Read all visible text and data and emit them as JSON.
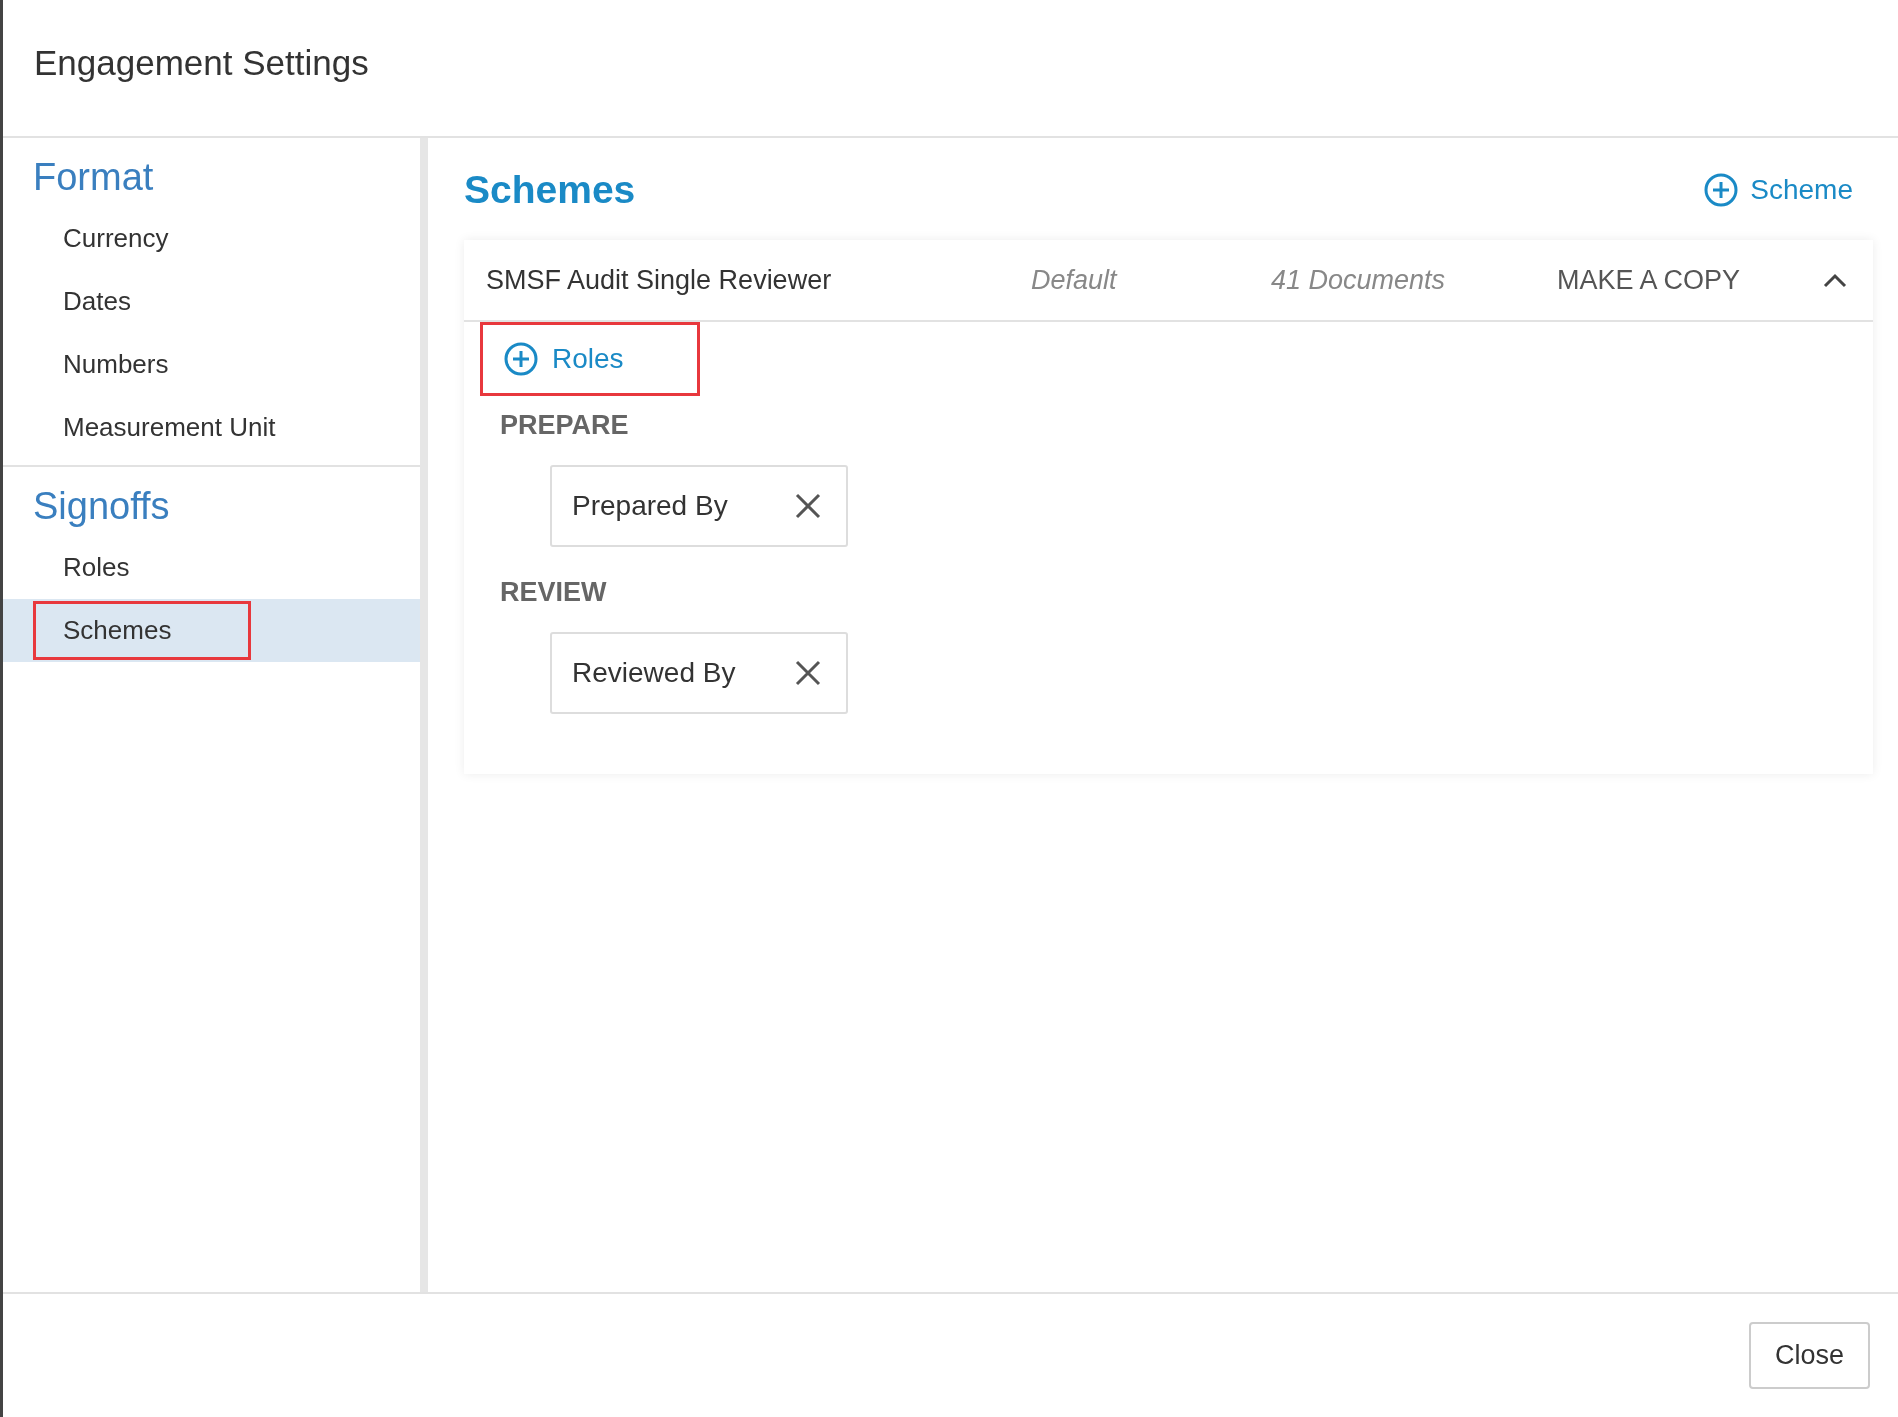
{
  "window": {
    "title": "Engagement Settings"
  },
  "sidebar": {
    "sections": [
      {
        "heading": "Format",
        "items": [
          {
            "label": "Currency",
            "selected": false,
            "highlighted": false
          },
          {
            "label": "Dates",
            "selected": false,
            "highlighted": false
          },
          {
            "label": "Numbers",
            "selected": false,
            "highlighted": false
          },
          {
            "label": "Measurement Unit",
            "selected": false,
            "highlighted": false
          }
        ]
      },
      {
        "heading": "Signoffs",
        "items": [
          {
            "label": "Roles",
            "selected": false,
            "highlighted": false
          },
          {
            "label": "Schemes",
            "selected": true,
            "highlighted": true
          }
        ]
      }
    ]
  },
  "content": {
    "title": "Schemes",
    "add_button": "Scheme",
    "schemes": [
      {
        "name": "SMSF Audit Single Reviewer",
        "status": "Default",
        "documents": "41 Documents",
        "copy_action": "MAKE A COPY",
        "expanded": true,
        "add_roles": {
          "label": "Roles",
          "highlighted": true
        },
        "stages": [
          {
            "heading": "PREPARE",
            "roles": [
              "Prepared By"
            ]
          },
          {
            "heading": "REVIEW",
            "roles": [
              "Reviewed By"
            ]
          }
        ]
      }
    ]
  },
  "footer": {
    "buttons": [
      "Close"
    ]
  }
}
